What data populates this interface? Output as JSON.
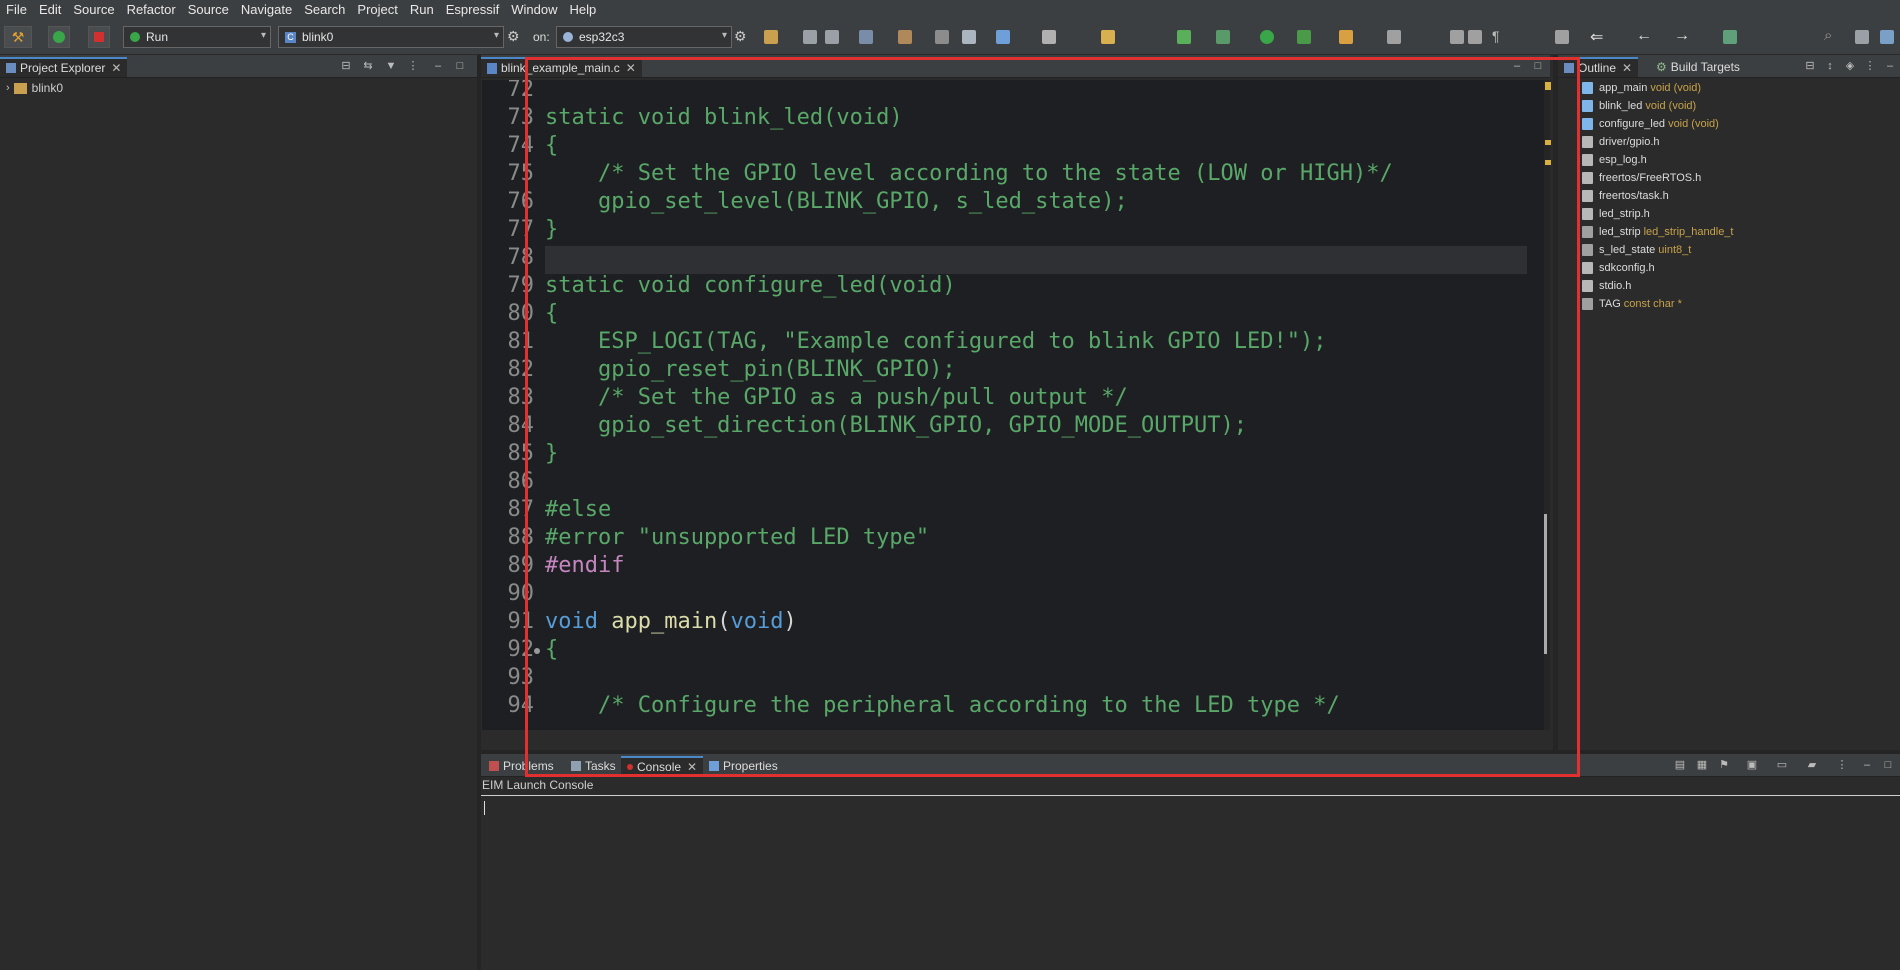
{
  "menu": [
    "File",
    "Edit",
    "Source",
    "Refactor",
    "Source",
    "Navigate",
    "Search",
    "Project",
    "Run",
    "Espressif",
    "Window",
    "Help"
  ],
  "toolbar": {
    "mode": "Run",
    "project": "blink0",
    "on_label": "on:",
    "target": "esp32c3"
  },
  "project_explorer": {
    "title": "Project Explorer",
    "items": [
      {
        "label": "blink0"
      }
    ]
  },
  "editor": {
    "tab": "blink_example_main.c",
    "lines": [
      {
        "n": "72",
        "t": ""
      },
      {
        "n": "73",
        "t": "static void blink_led(void)"
      },
      {
        "n": "74",
        "t": "{"
      },
      {
        "n": "75",
        "t": "    /* Set the GPIO level according to the state (LOW or HIGH)*/"
      },
      {
        "n": "76",
        "t": "    gpio_set_level(BLINK_GPIO, s_led_state);"
      },
      {
        "n": "77",
        "t": "}"
      },
      {
        "n": "78",
        "t": ""
      },
      {
        "n": "79",
        "t": "static void configure_led(void)"
      },
      {
        "n": "80",
        "t": "{"
      },
      {
        "n": "81",
        "t": "    ESP_LOGI(TAG, \"Example configured to blink GPIO LED!\");"
      },
      {
        "n": "82",
        "t": "    gpio_reset_pin(BLINK_GPIO);"
      },
      {
        "n": "83",
        "t": "    /* Set the GPIO as a push/pull output */"
      },
      {
        "n": "84",
        "t": "    gpio_set_direction(BLINK_GPIO, GPIO_MODE_OUTPUT);"
      },
      {
        "n": "85",
        "t": "}"
      },
      {
        "n": "86",
        "t": ""
      },
      {
        "n": "87",
        "t": "#else"
      },
      {
        "n": "88",
        "t": "#error \"unsupported LED type\""
      },
      {
        "n": "89",
        "t": "#endif"
      },
      {
        "n": "90",
        "t": ""
      },
      {
        "n": "91",
        "t": ""
      },
      {
        "n": "92",
        "t": "{"
      },
      {
        "n": "93",
        "t": ""
      },
      {
        "n": "94",
        "t": "    /* Configure the peripheral according to the LED type */"
      }
    ],
    "main_sig": {
      "kw1": "void",
      "fn": "app_main",
      "open": "(",
      "kw2": "void",
      "close": ")"
    }
  },
  "outline": {
    "tabs": [
      "Outline",
      "Build Targets"
    ],
    "items": [
      {
        "name": "app_main",
        "type": "void (void)",
        "kind": "function"
      },
      {
        "name": "blink_led",
        "type": "void (void)",
        "kind": "function"
      },
      {
        "name": "configure_led",
        "type": "void (void)",
        "kind": "function"
      },
      {
        "name": "driver/gpio.h",
        "type": "",
        "kind": "include"
      },
      {
        "name": "esp_log.h",
        "type": "",
        "kind": "include"
      },
      {
        "name": "freertos/FreeRTOS.h",
        "type": "",
        "kind": "include"
      },
      {
        "name": "freertos/task.h",
        "type": "",
        "kind": "include"
      },
      {
        "name": "led_strip.h",
        "type": "",
        "kind": "include"
      },
      {
        "name": "led_strip",
        "type": "led_strip_handle_t",
        "kind": "variable"
      },
      {
        "name": "s_led_state",
        "type": "uint8_t",
        "kind": "variable"
      },
      {
        "name": "sdkconfig.h",
        "type": "",
        "kind": "include"
      },
      {
        "name": "stdio.h",
        "type": "",
        "kind": "include"
      },
      {
        "name": "TAG",
        "type": "const char *",
        "kind": "variable"
      }
    ]
  },
  "console": {
    "tabs": [
      "Problems",
      "Tasks",
      "Console",
      "Properties"
    ],
    "active": "Console",
    "header": "EIM Launch Console"
  },
  "colors": {
    "accent": "#4a88c7",
    "highlight_box": "#e03030",
    "comment": "#59a869",
    "keyword": "#569cd6",
    "function": "#dcdcaa",
    "preprocessor": "#c586c0"
  }
}
